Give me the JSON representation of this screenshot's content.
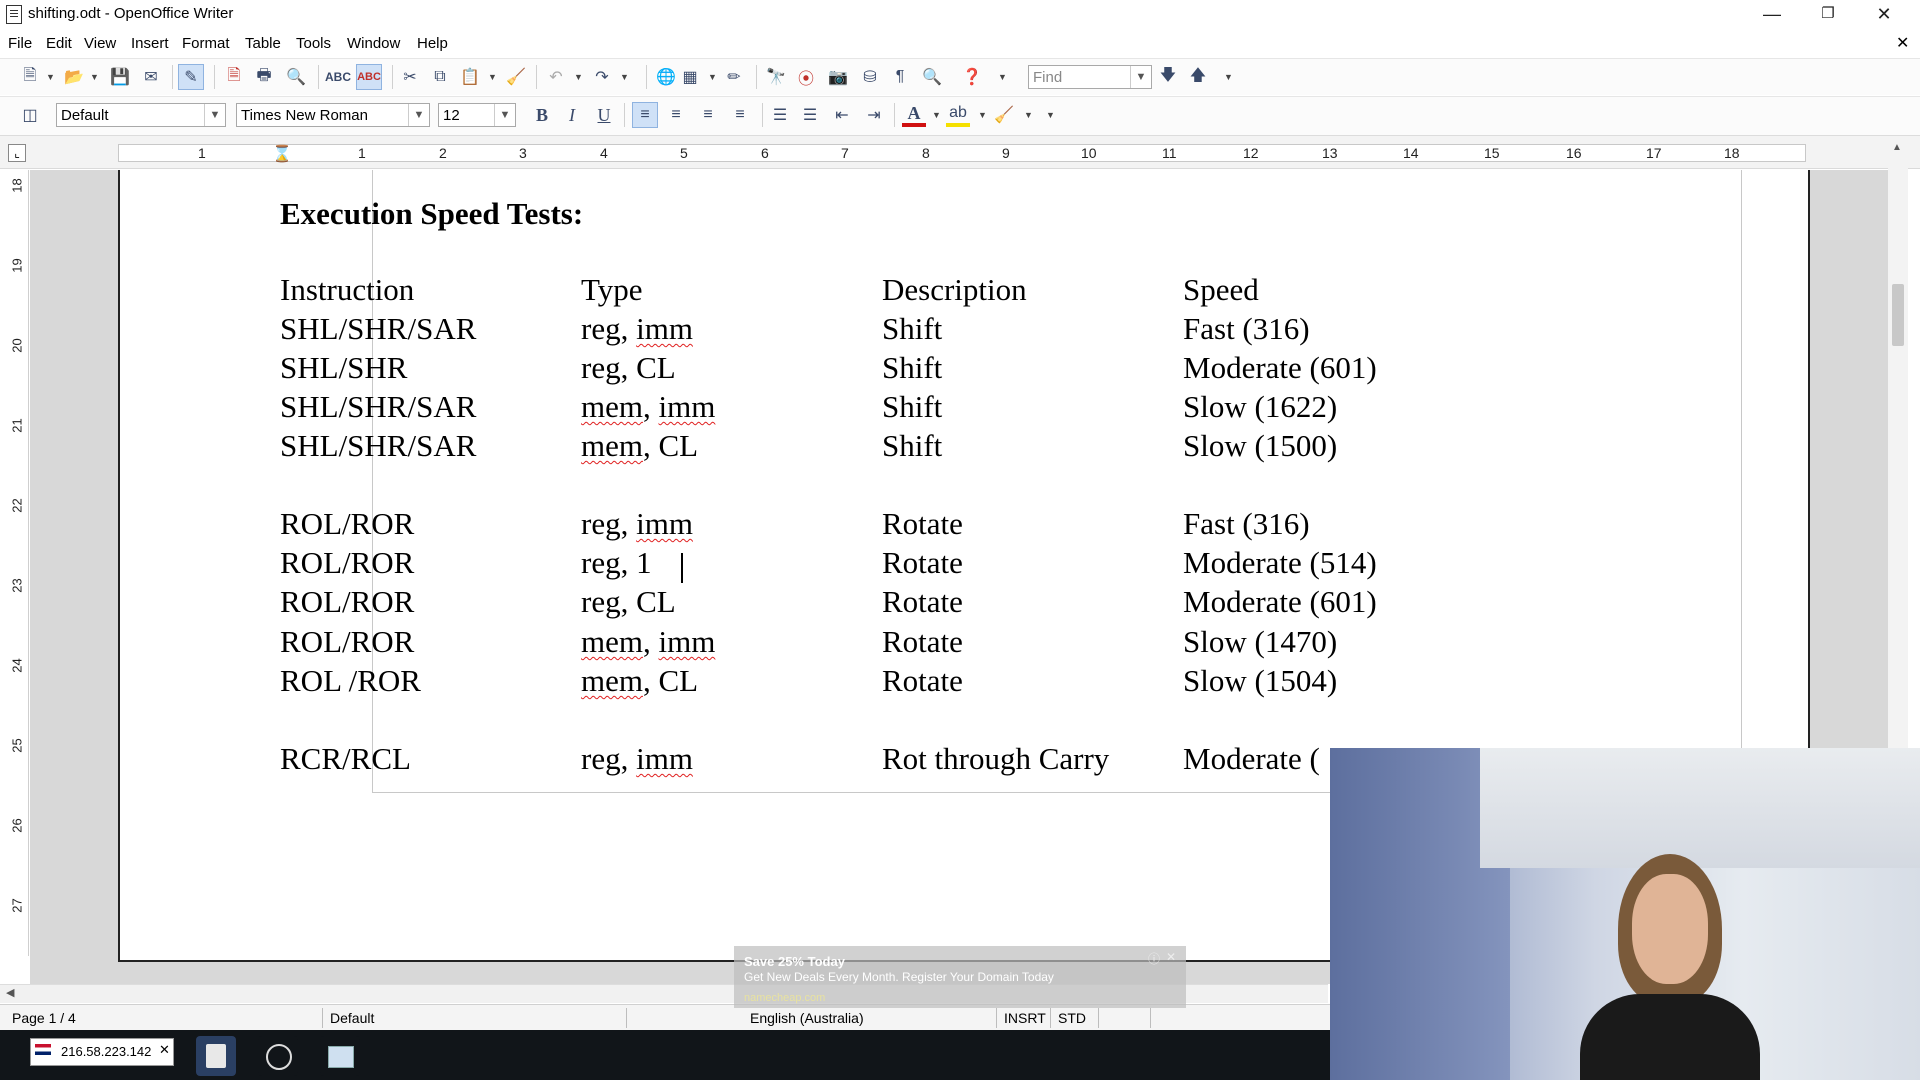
{
  "window": {
    "title": "shifting.odt - OpenOffice Writer"
  },
  "menu": {
    "items": [
      "File",
      "Edit",
      "View",
      "Insert",
      "Format",
      "Table",
      "Tools",
      "Window",
      "Help"
    ]
  },
  "toolbar": {
    "find_placeholder": "Find"
  },
  "formatting": {
    "paragraph_style": "Default",
    "font_name": "Times New Roman",
    "font_size": "12",
    "bold_label": "B",
    "italic_label": "I",
    "underline_label": "U"
  },
  "ruler": {
    "h_ticks": [
      "1",
      "1",
      "2",
      "3",
      "4",
      "5",
      "6",
      "7",
      "8",
      "9",
      "10",
      "11",
      "12",
      "13",
      "14",
      "15",
      "16",
      "17",
      "18"
    ],
    "v_ticks": [
      "18",
      "19",
      "20",
      "21",
      "22",
      "23",
      "24",
      "25",
      "26",
      "27"
    ]
  },
  "document": {
    "heading": "Execution Speed Tests:",
    "columns": [
      "Instruction",
      "Type",
      "Description",
      "Speed"
    ],
    "rows": [
      [
        "SHL/SHR/SAR",
        "reg, imm",
        "Shift",
        "Fast (316)"
      ],
      [
        "SHL/SHR",
        "reg, CL",
        "Shift",
        "Moderate (601)"
      ],
      [
        "SHL/SHR/SAR",
        "mem, imm",
        "Shift",
        "Slow (1622)"
      ],
      [
        "SHL/SHR/SAR",
        "mem, CL",
        "Shift",
        "Slow (1500)"
      ],
      [
        "ROL/ROR",
        "reg, imm",
        "Rotate",
        "Fast (316)"
      ],
      [
        "ROL/ROR",
        "reg, 1",
        "Rotate",
        "Moderate (514)"
      ],
      [
        "ROL/ROR",
        "reg, CL",
        "Rotate",
        "Moderate (601)"
      ],
      [
        "ROL/ROR",
        "mem, imm",
        "Rotate",
        "Slow (1470)"
      ],
      [
        "ROL /ROR",
        "mem, CL",
        "Rotate",
        "Slow (1504)"
      ],
      [
        "RCR/RCL",
        "reg, imm",
        "Rot through Carry",
        "Moderate ("
      ]
    ]
  },
  "status": {
    "page": "Page 1 / 4",
    "style": "Default",
    "language": "English (Australia)",
    "insert_mode": "INSRT",
    "selection_mode": "STD"
  },
  "taskbar": {
    "ip": "216.58.223.142"
  },
  "ad": {
    "headline": "Save 25% Today",
    "body": "Get New Deals Every Month. Register Your Domain Today",
    "source": "namecheap.com"
  }
}
